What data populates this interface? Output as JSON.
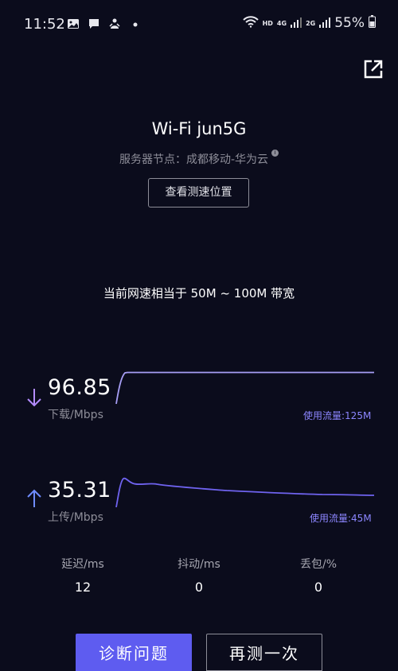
{
  "status_bar": {
    "time": "11:52",
    "signal_labels": [
      "HD",
      "4G",
      "2G"
    ],
    "battery": "55%"
  },
  "network": {
    "name": "Wi-Fi jun5G",
    "server_node": "服务器节点：成都移动-华为云",
    "view_location_label": "查看测速位置"
  },
  "bandwidth_text": "当前网速相当于 50M ~ 100M 带宽",
  "download": {
    "speed": "96.85",
    "unit": "下载/Mbps",
    "usage": "使用流量:125M"
  },
  "upload": {
    "speed": "35.31",
    "unit": "上传/Mbps",
    "usage": "使用流量:45M"
  },
  "stats": [
    {
      "label": "延迟/ms",
      "value": "12"
    },
    {
      "label": "抖动/ms",
      "value": "0"
    },
    {
      "label": "丢包/%",
      "value": "0"
    }
  ],
  "actions": {
    "diagnose_label": "诊断问题",
    "retest_label": "再测一次"
  },
  "colors": {
    "background": "#0b0c1c",
    "accent": "#5e5cf0",
    "download_arrow": "#b48cff",
    "upload_arrow": "#6f8cff"
  }
}
